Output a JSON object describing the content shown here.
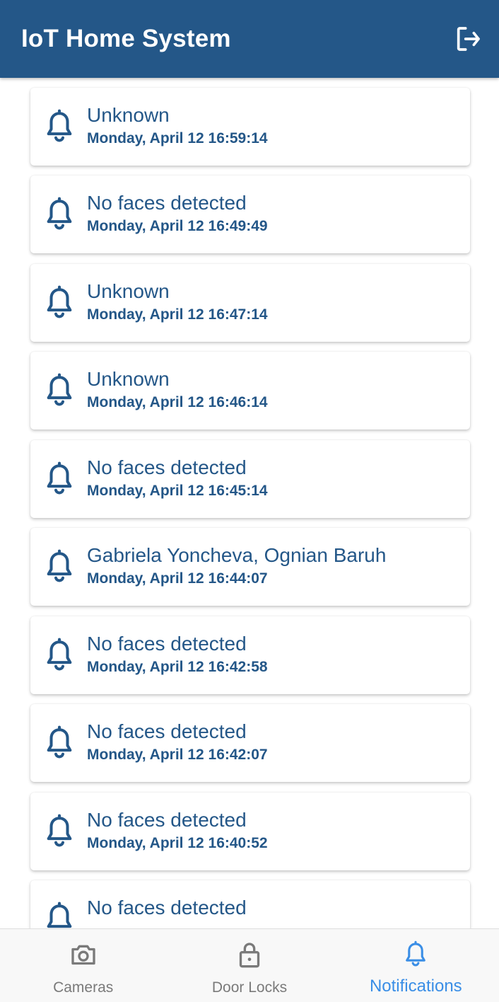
{
  "app": {
    "title": "IoT Home System",
    "logout_icon": "logout-icon"
  },
  "colors": {
    "primary": "#245788",
    "active_tab": "#3a8ee6",
    "inactive_tab": "#7a7a7a"
  },
  "notifications": [
    {
      "title": "Unknown",
      "time": "Monday, April 12 16:59:14",
      "icon": "bell-icon"
    },
    {
      "title": "No faces detected",
      "time": "Monday, April 12 16:49:49",
      "icon": "bell-icon"
    },
    {
      "title": "Unknown",
      "time": "Monday, April 12 16:47:14",
      "icon": "bell-icon"
    },
    {
      "title": "Unknown",
      "time": "Monday, April 12 16:46:14",
      "icon": "bell-icon"
    },
    {
      "title": "No faces detected",
      "time": "Monday, April 12 16:45:14",
      "icon": "bell-icon"
    },
    {
      "title": "Gabriela Yoncheva, Ognian Baruh",
      "time": "Monday, April 12 16:44:07",
      "icon": "bell-icon"
    },
    {
      "title": "No faces detected",
      "time": "Monday, April 12 16:42:58",
      "icon": "bell-icon"
    },
    {
      "title": "No faces detected",
      "time": "Monday, April 12 16:42:07",
      "icon": "bell-icon"
    },
    {
      "title": "No faces detected",
      "time": "Monday, April 12 16:40:52",
      "icon": "bell-icon"
    },
    {
      "title": "No faces detected",
      "time": "",
      "icon": "bell-icon"
    }
  ],
  "bottom_nav": {
    "items": [
      {
        "label": "Cameras",
        "icon": "camera-icon",
        "active": false
      },
      {
        "label": "Door Locks",
        "icon": "lock-icon",
        "active": false
      },
      {
        "label": "Notifications",
        "icon": "bell-icon",
        "active": true
      }
    ]
  }
}
